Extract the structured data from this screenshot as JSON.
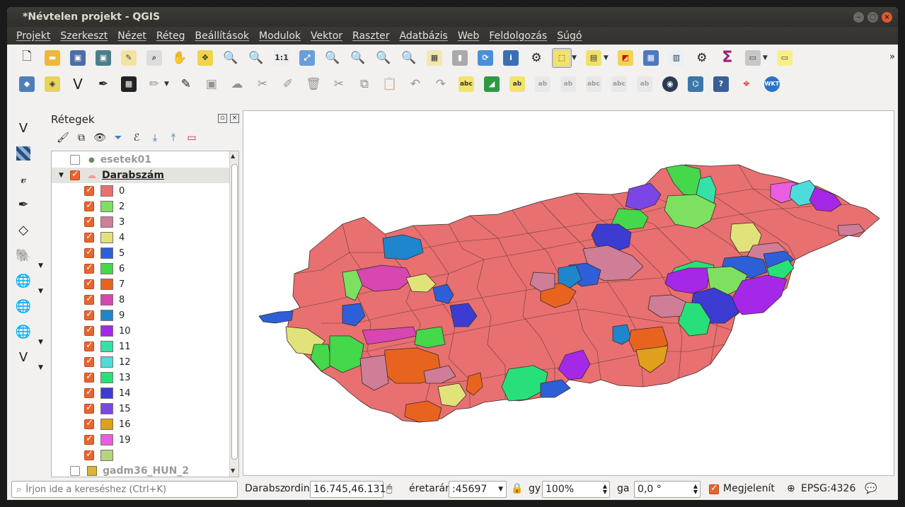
{
  "window": {
    "title": "*Névtelen projekt - QGIS"
  },
  "menu": [
    "Projekt",
    "Szerkeszt",
    "Nézet",
    "Réteg",
    "Beállítások",
    "Modulok",
    "Vektor",
    "Raszter",
    "Adatbázis",
    "Web",
    "Feldolgozás",
    "Súgó"
  ],
  "toolbar1": {
    "icons": [
      "new-project-icon",
      "open-project-icon",
      "save-project-icon",
      "save-as-icon",
      "new-print-layout-icon",
      "layout-manager-icon",
      "pan-icon",
      "pan-to-selection-icon",
      "zoom-in-icon",
      "zoom-out-icon",
      "zoom-native-icon",
      "zoom-full-icon",
      "zoom-to-selection-icon",
      "zoom-to-layer-icon",
      "zoom-last-icon",
      "zoom-next-icon",
      "new-map-view-icon",
      "temporal-icon",
      "refresh-icon",
      "identify-icon",
      "action-icon",
      "select-features-icon",
      "attribute-table-icon",
      "deselect-icon",
      "open-field-calculator-icon",
      "statistics-icon",
      "settings-icon",
      "sum-icon",
      "measure-icon",
      "annotation-icon"
    ]
  },
  "toolbar2": {
    "wkt_label": "WKT",
    "abc_label": "abc"
  },
  "layers_panel": {
    "title": "Rétegek",
    "layers": [
      {
        "name": "esetek01",
        "checked": false,
        "active": false
      },
      {
        "name": "Darabszám",
        "checked": true,
        "active": true
      },
      {
        "name": "gadm36_HUN_2",
        "checked": false,
        "active": false
      }
    ],
    "classes": [
      {
        "label": "0",
        "color": "#e87070"
      },
      {
        "label": "2",
        "color": "#7de060"
      },
      {
        "label": "3",
        "color": "#d07d98"
      },
      {
        "label": "4",
        "color": "#e2e27a"
      },
      {
        "label": "5",
        "color": "#2d5fd8"
      },
      {
        "label": "6",
        "color": "#44d84a"
      },
      {
        "label": "7",
        "color": "#e8641e"
      },
      {
        "label": "8",
        "color": "#d846b2"
      },
      {
        "label": "9",
        "color": "#1e86cc"
      },
      {
        "label": "10",
        "color": "#a528e8"
      },
      {
        "label": "11",
        "color": "#36e0a8"
      },
      {
        "label": "12",
        "color": "#4ddcdc"
      },
      {
        "label": "13",
        "color": "#28e07a"
      },
      {
        "label": "14",
        "color": "#3c3cd2"
      },
      {
        "label": "15",
        "color": "#7a46e6"
      },
      {
        "label": "16",
        "color": "#e0a01c"
      },
      {
        "label": "19",
        "color": "#ea5ce0"
      },
      {
        "label": "",
        "color": "#b6d47c"
      }
    ]
  },
  "status": {
    "search_placeholder": "Írjon ide a kereséshez (Ctrl+K)",
    "darab_label": "Darabsz",
    "coord_label": "ordin",
    "coord_value": "16.745,46.131",
    "scale_label": "éretarár",
    "scale_value": ":45697",
    "mag_label": "gy",
    "mag_value": "100%",
    "rot_label": "ga",
    "rot_value": "0,0 °",
    "render_label": "Megjelenít",
    "crs_label": "EPSG:4326"
  }
}
